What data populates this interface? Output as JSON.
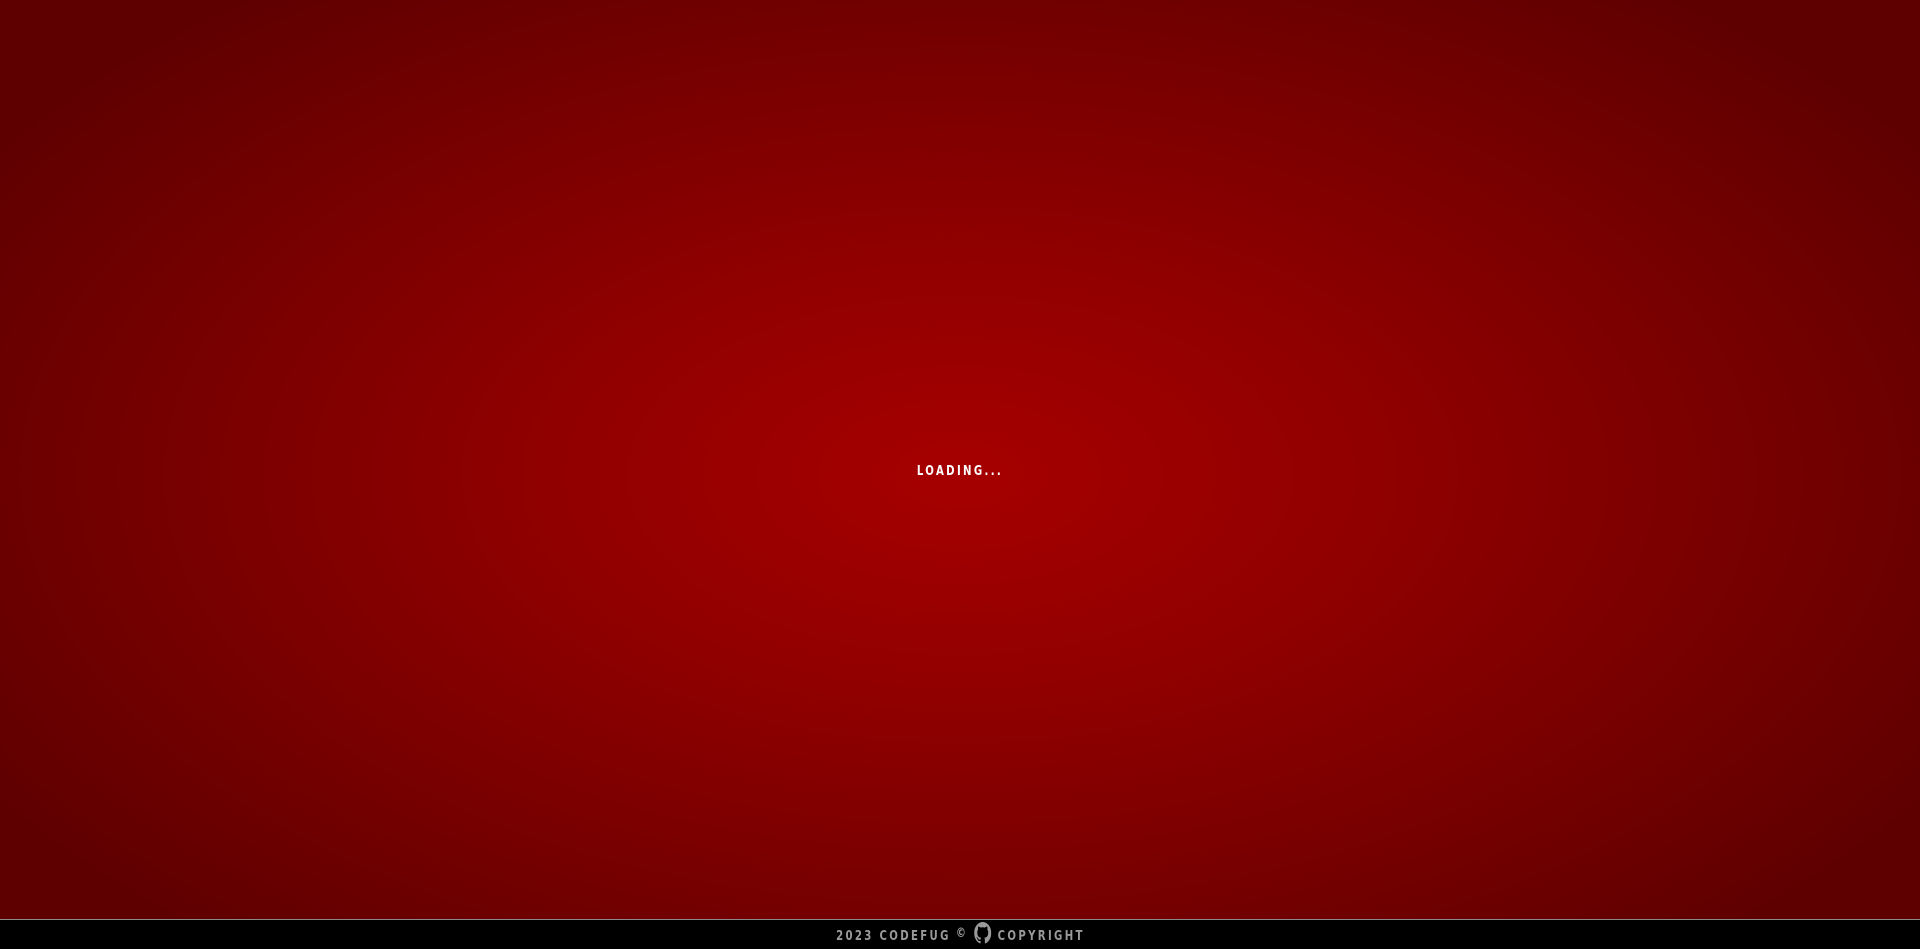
{
  "loading": {
    "text": "LOADING..."
  },
  "footer": {
    "left_text": "2023 CODEFUG",
    "copyright_symbol": "©",
    "github_icon": "github-icon",
    "right_text": "COPYRIGHT"
  },
  "colors": {
    "background_center": "#a60000",
    "background_edge": "#5e0000",
    "footer_background": "#000000",
    "footer_text": "#9a9a9a",
    "loading_text": "#ffffff"
  }
}
